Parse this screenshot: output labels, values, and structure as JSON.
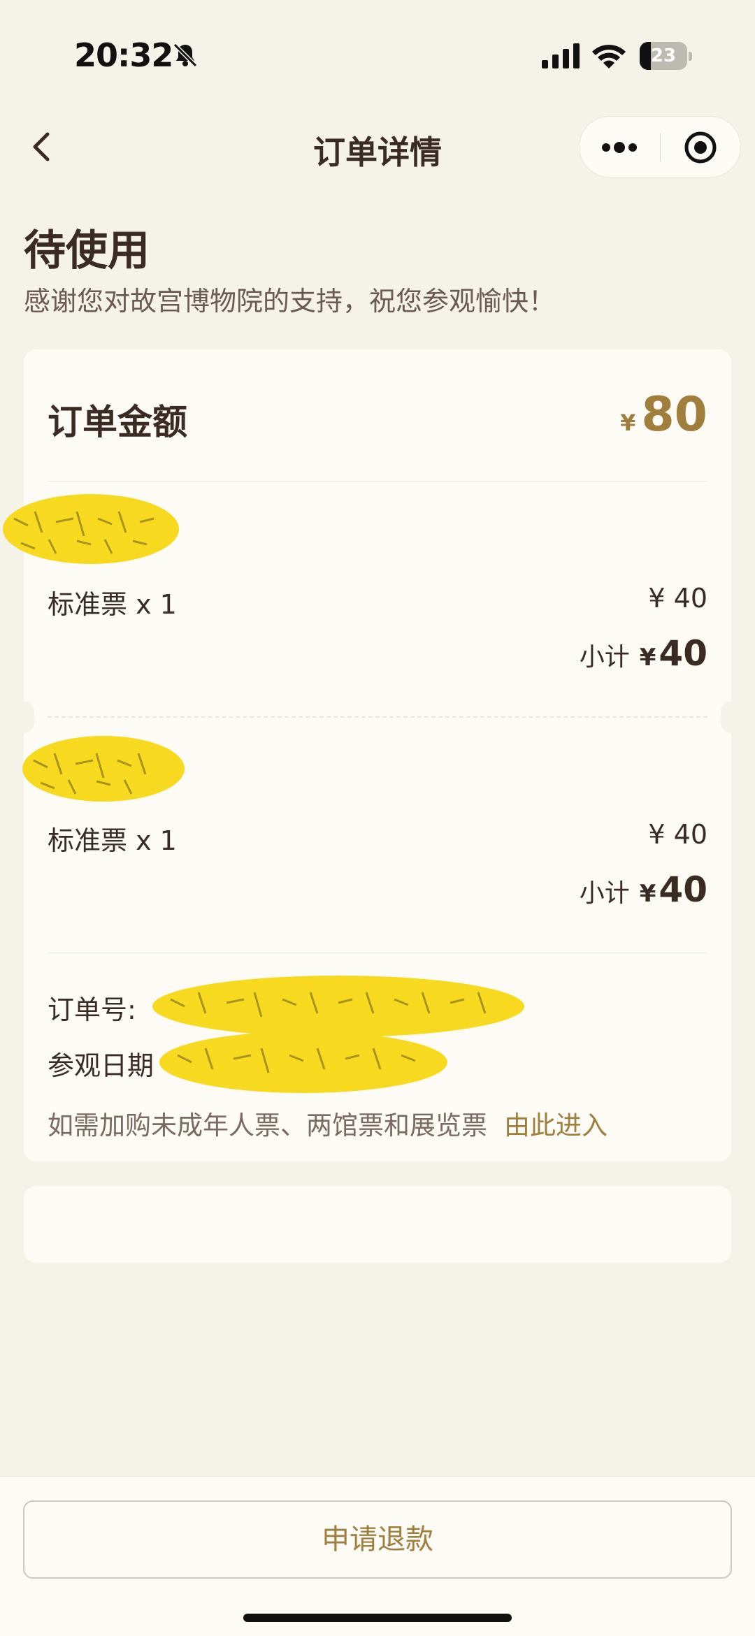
{
  "status_bar": {
    "time": "20:32",
    "battery": "23",
    "battery_level": 0.23,
    "icons": [
      "bell-muted-icon",
      "signal-icon",
      "wifi-icon",
      "battery-icon"
    ]
  },
  "nav": {
    "title": "订单详情",
    "icons": [
      "back-icon",
      "more-icon",
      "close-mini-program-icon"
    ]
  },
  "order_status": {
    "title": "待使用",
    "subtitle": "感谢您对故宫博物院的支持，祝您参观愉快！"
  },
  "order": {
    "amount_label": "订单金额",
    "currency_small": "¥",
    "amount": "80",
    "tickets": [
      {
        "name": "标准票 x 1",
        "price": "¥ 40",
        "subtotal_label": "小计",
        "subtotal_currency": "¥",
        "subtotal": "40"
      },
      {
        "name": "标准票 x 1",
        "price": "¥ 40",
        "subtotal_label": "小计",
        "subtotal_currency": "¥",
        "subtotal": "40"
      }
    ],
    "order_no_label": "订单号:",
    "visit_date_label": "参观日期",
    "extra_text": "如需加购未成年人票、两馆票和展览票",
    "extra_link": "由此进入"
  },
  "actions": {
    "refund": "申请退款"
  },
  "colors": {
    "background": "#f5f2e9",
    "card": "#fdfbf6",
    "accent_gold": "#a07e3c",
    "text_dark": "#3b2b25",
    "redaction_yellow": "#f7da1f"
  }
}
